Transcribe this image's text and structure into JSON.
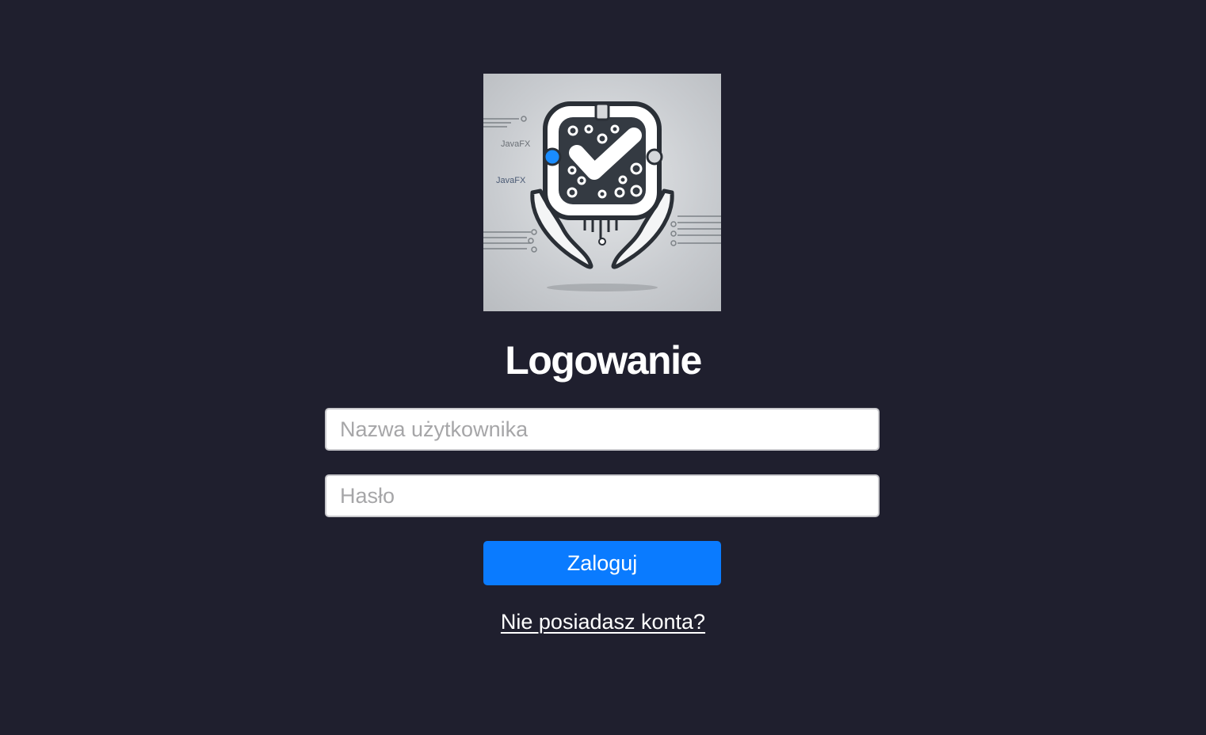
{
  "logo": {
    "icon": "chip-checkmark-hands-icon",
    "caption_1": "JavaFX",
    "caption_2": "JavaFX"
  },
  "title": "Logowanie",
  "form": {
    "username_placeholder": "Nazwa użytkownika",
    "username_value": "",
    "password_placeholder": "Hasło",
    "password_value": "",
    "submit_label": "Zaloguj",
    "register_link": "Nie posiadasz konta?"
  },
  "colors": {
    "background": "#1f1f2e",
    "accent": "#0a7bff",
    "text": "#ffffff"
  }
}
